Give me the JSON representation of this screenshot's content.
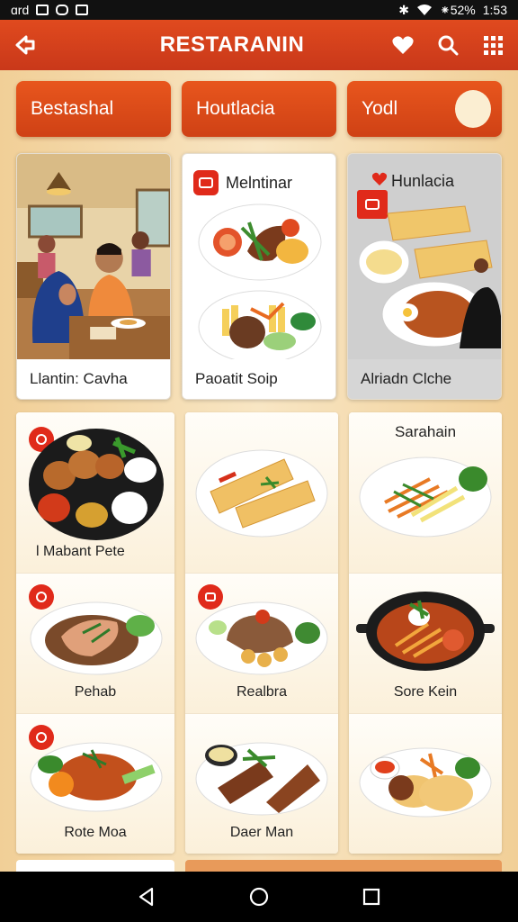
{
  "status": {
    "left": "ɑrd",
    "right": "⁕52%",
    "time": "1:53"
  },
  "app_bar": {
    "title": "RESTARANIN"
  },
  "categories": [
    {
      "label": "Bestashal"
    },
    {
      "label": "Houtlacia"
    },
    {
      "label": "Yodl"
    }
  ],
  "featured": [
    {
      "title": "",
      "caption": "Llantin: Cavha"
    },
    {
      "title": "Melntinar",
      "caption": "Paoatit Soip"
    },
    {
      "title": "Hunlacia",
      "caption": "Alriadn Clche"
    }
  ],
  "grid": [
    [
      {
        "label": "l Mabant Pete"
      },
      {
        "label": "Pehab"
      },
      {
        "label": "Rote Moa"
      }
    ],
    [
      {
        "label": ""
      },
      {
        "label": "Realbra"
      },
      {
        "label": "Daer Man"
      }
    ],
    [
      {
        "top": "Sarahain",
        "label": ""
      },
      {
        "label": "Sore Kein"
      },
      {
        "label": ""
      }
    ]
  ],
  "colors": {
    "accent": "#d9401a",
    "badge": "#e02a1a",
    "bg": "#f3d9ae"
  }
}
